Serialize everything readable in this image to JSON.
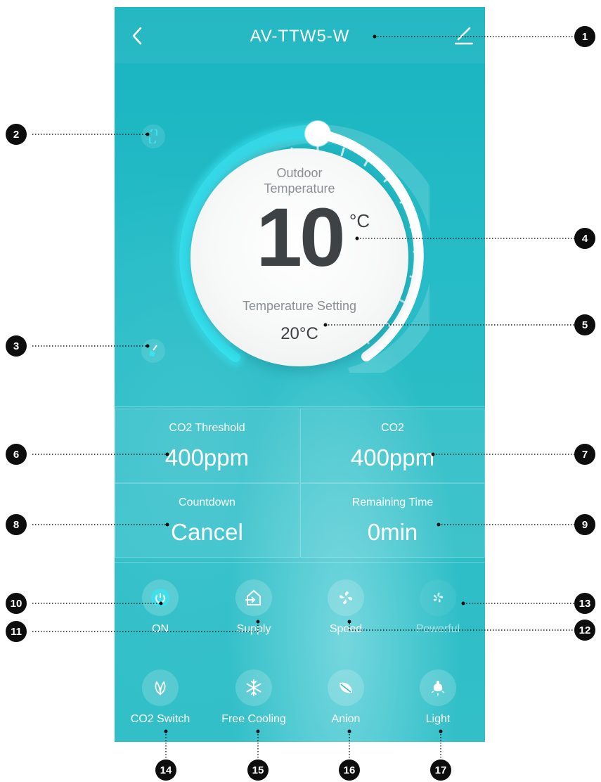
{
  "header": {
    "title": "AV-TTW5-W"
  },
  "dial": {
    "outdoor_label": "Outdoor\nTemperature",
    "outdoor_value": "10",
    "unit": "°C",
    "setting_label": "Temperature Setting",
    "setting_value": "20°C"
  },
  "stats": [
    {
      "label": "CO2 Threshold",
      "value": "400ppm"
    },
    {
      "label": "CO2",
      "value": "400ppm"
    },
    {
      "label": "Countdown",
      "value": "Cancel"
    },
    {
      "label": "Remaining Time",
      "value": "0min"
    }
  ],
  "controls": [
    {
      "label": "ON",
      "icon": "power-icon"
    },
    {
      "label": "Supply",
      "icon": "supply-icon"
    },
    {
      "label": "Speed",
      "icon": "fan-icon"
    },
    {
      "label": "Powerful",
      "icon": "powerful-fan-icon"
    },
    {
      "label": "CO2 Switch",
      "icon": "leaf-outline-icon"
    },
    {
      "label": "Free Cooling",
      "icon": "snowflake-icon"
    },
    {
      "label": "Anion",
      "icon": "leaf-icon"
    },
    {
      "label": "Light",
      "icon": "bulb-icon"
    }
  ],
  "callouts": [
    "1",
    "2",
    "3",
    "4",
    "5",
    "6",
    "7",
    "8",
    "9",
    "10",
    "11",
    "12",
    "13",
    "14",
    "15",
    "16",
    "17"
  ],
  "colors": {
    "background": "#26bcc7",
    "dial_accent": "#35e3f0",
    "text_dark": "#3e4245"
  }
}
